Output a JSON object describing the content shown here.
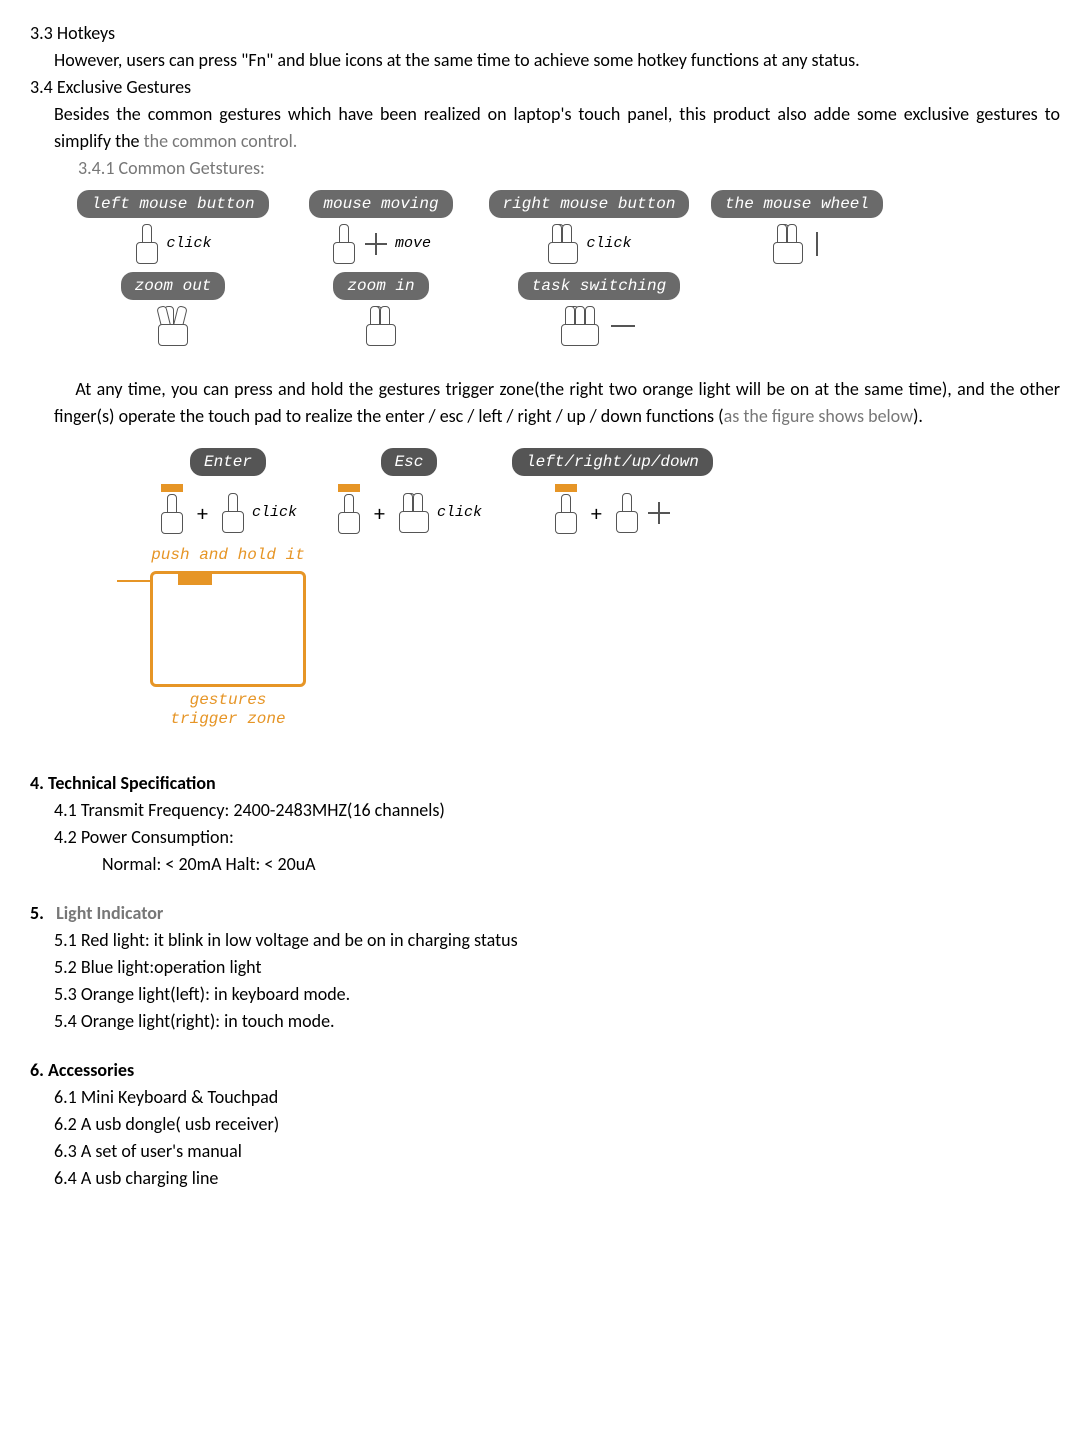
{
  "s33": {
    "heading": "3.3 Hotkeys",
    "body": "However, users can press \"Fn\" and blue icons at the same time to achieve some hotkey functions at any status."
  },
  "s34": {
    "heading": "3.4 Exclusive Gestures",
    "body_a": "Besides the common gestures which have been realized on laptop's touch panel, this product also adde some exclusive gestures to simplify the ",
    "body_b": "the common control.",
    "sub": "3.4.1    Common Getstures:"
  },
  "gestures": {
    "left_mouse": "left mouse button",
    "click1": "click",
    "mouse_moving": "mouse moving",
    "move": "move",
    "right_mouse": "right mouse button",
    "click2": "click",
    "mouse_wheel": "the mouse wheel",
    "zoom_out": "zoom out",
    "zoom_in": "zoom in",
    "task_switch": "task switching"
  },
  "trigger": {
    "para": "At any time, you can press and hold the gestures trigger zone(the right two orange light will be on at the same time), and the other finger(s) operate the touch pad to realize the enter / esc / left / right / up / down functions (",
    "para_gray": "as the figure shows below",
    "para_end": ").",
    "enter": "Enter",
    "esc": "Esc",
    "lrud": "left/right/up/down",
    "click": "click",
    "push_hold": "push and hold it",
    "zone": "gestures\ntrigger zone"
  },
  "s4": {
    "heading": "4.   Technical Specification",
    "l1": "4.1 Transmit Frequency: 2400-2483MHZ(16 channels)",
    "l2": "4.2 Power Consumption:",
    "l3": "Normal: < 20mA    Halt: < 20uA"
  },
  "s5": {
    "heading": "5.   Light Indicator",
    "l1": "5.1 Red light: it blink in low voltage and be on in charging status",
    "l2": "5.2 Blue light:operation light",
    "l3": "5.3 Orange light(left): in keyboard mode.",
    "l4": "5.4 Orange light(right): in touch mode."
  },
  "s6": {
    "heading": "6.   Accessories",
    "l1": "6.1 Mini Keyboard & Touchpad",
    "l2": "6.2 A usb dongle( usb receiver)",
    "l3": "6.3 A set of user's manual",
    "l4": "6.4 A usb charging line"
  }
}
